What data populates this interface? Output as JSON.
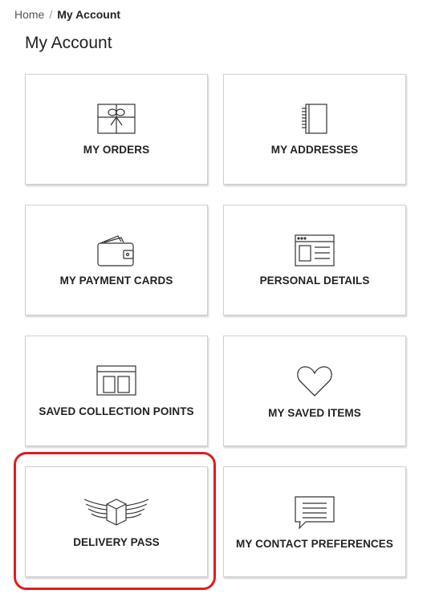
{
  "breadcrumb": {
    "home": "Home",
    "separator": "/",
    "current": "My Account"
  },
  "page": {
    "title": "My Account"
  },
  "tiles": [
    {
      "label": "MY ORDERS",
      "icon": "gift-box-icon"
    },
    {
      "label": "MY ADDRESSES",
      "icon": "address-book-icon"
    },
    {
      "label": "MY PAYMENT CARDS",
      "icon": "wallet-icon"
    },
    {
      "label": "PERSONAL DETAILS",
      "icon": "profile-window-icon"
    },
    {
      "label": "SAVED COLLECTION POINTS",
      "icon": "shop-front-icon"
    },
    {
      "label": "MY SAVED ITEMS",
      "icon": "heart-icon"
    },
    {
      "label": "DELIVERY PASS",
      "icon": "winged-box-icon"
    },
    {
      "label": "MY CONTACT PREFERENCES",
      "icon": "speech-bubble-icon"
    }
  ],
  "colors": {
    "highlight": "#e31b1b",
    "tile_border": "#cfcfcf",
    "text": "#222222"
  }
}
